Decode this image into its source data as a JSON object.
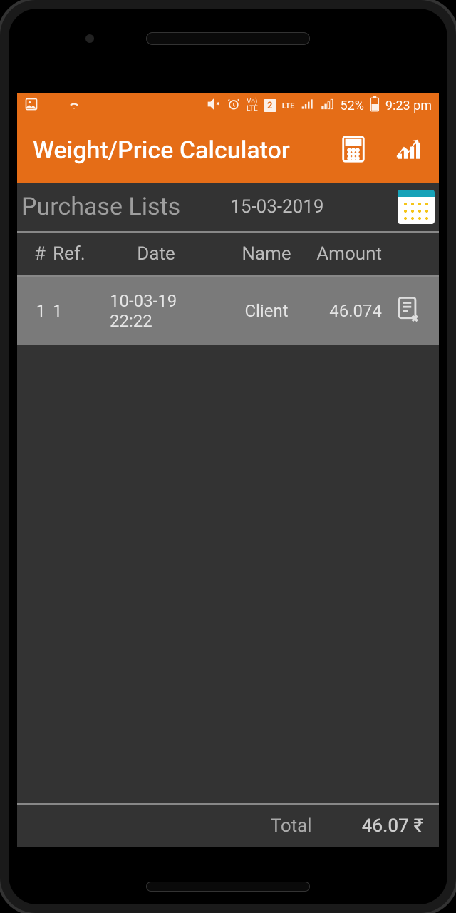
{
  "status_bar": {
    "battery_pct": "52%",
    "time": "9:23 pm"
  },
  "app_bar": {
    "title": "Weight/Price Calculator"
  },
  "subheader": {
    "title": "Purchase Lists",
    "date": "15-03-2019"
  },
  "table": {
    "headers": {
      "num": "#",
      "ref": "Ref.",
      "date": "Date",
      "name": "Name",
      "amount": "Amount"
    },
    "rows": [
      {
        "num": "1",
        "ref": "1",
        "date": "10-03-19 22:22",
        "name": "Client",
        "amount": "46.074"
      }
    ]
  },
  "footer": {
    "label": "Total",
    "value": "46.07 ₹"
  }
}
